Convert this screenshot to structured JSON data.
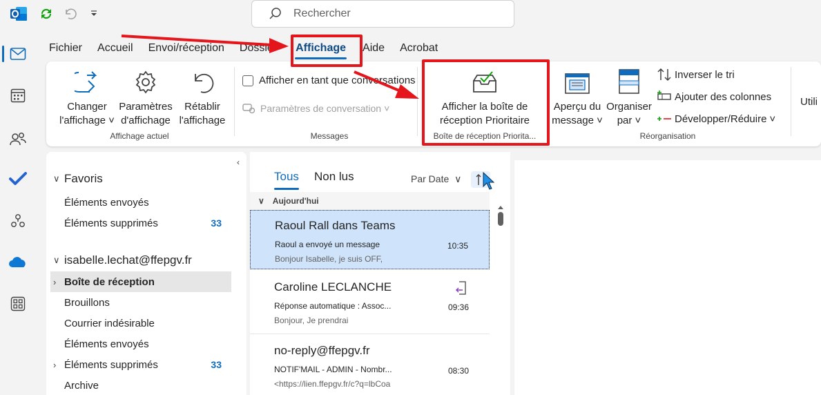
{
  "search": {
    "placeholder": "Rechercher"
  },
  "menu": {
    "tabs": [
      {
        "label": "Fichier"
      },
      {
        "label": "Accueil"
      },
      {
        "label": "Envoi/réception"
      },
      {
        "label": "Dossier"
      },
      {
        "label": "Affichage"
      },
      {
        "label": "Aide"
      },
      {
        "label": "Acrobat"
      }
    ]
  },
  "ribbon": {
    "current_view": {
      "change_line1": "Changer",
      "change_line2": "l'affichage",
      "params_line1": "Paramètres",
      "params_line2": "d'affichage",
      "reset_line1": "Rétablir",
      "reset_line2": "l'affichage",
      "group": "Affichage actuel"
    },
    "messages": {
      "show_as_conv": "Afficher en tant que conversations",
      "conv_settings": "Paramètres de conversation",
      "group": "Messages"
    },
    "focused": {
      "line1": "Afficher la boîte de",
      "line2": "réception Prioritaire",
      "group": "Boîte de réception Priorita..."
    },
    "arrangement": {
      "preview_line1": "Aperçu du",
      "preview_line2": "message",
      "arrange_line1": "Organiser",
      "arrange_line2": "par",
      "reverse": "Inverser le tri",
      "add_cols": "Ajouter des colonnes",
      "expand": "Développer/Réduire",
      "group": "Réorganisation"
    },
    "cut_off": "Utili"
  },
  "folders": {
    "favorites_header": "Favoris",
    "favorites": [
      {
        "label": "Éléments envoyés",
        "count": ""
      },
      {
        "label": "Éléments supprimés",
        "count": "33"
      }
    ],
    "account": "isabelle.lechat@ffepgv.fr",
    "items": [
      {
        "label": "Boîte de réception",
        "count": ""
      },
      {
        "label": "Brouillons",
        "count": ""
      },
      {
        "label": "Courrier indésirable",
        "count": ""
      },
      {
        "label": "Éléments envoyés",
        "count": ""
      },
      {
        "label": "Éléments supprimés",
        "count": "33"
      },
      {
        "label": "Archive",
        "count": ""
      }
    ]
  },
  "message_list": {
    "tab_all": "Tous",
    "tab_unread": "Non lus",
    "sort": "Par Date",
    "group_today": "Aujourd'hui",
    "messages": [
      {
        "sender": "Raoul Rall dans Teams",
        "subject": "Raoul a envoyé un message",
        "preview": "Bonjour Isabelle, je suis OFF,",
        "time": "10:35"
      },
      {
        "sender": "Caroline LECLANCHE",
        "subject": "Réponse automatique : Assoc...",
        "preview": "Bonjour,  Je prendrai",
        "time": "09:36"
      },
      {
        "sender": "no-reply@ffepgv.fr",
        "subject": "NOTIF'MAIL - ADMIN - Nombr...",
        "preview": "<https://lien.ffepgv.fr/c?q=lbCoa",
        "time": "08:30"
      }
    ]
  },
  "colors": {
    "accent": "#0f6cbd",
    "annotation": "#e4151b",
    "selected": "#cfe4fa"
  }
}
